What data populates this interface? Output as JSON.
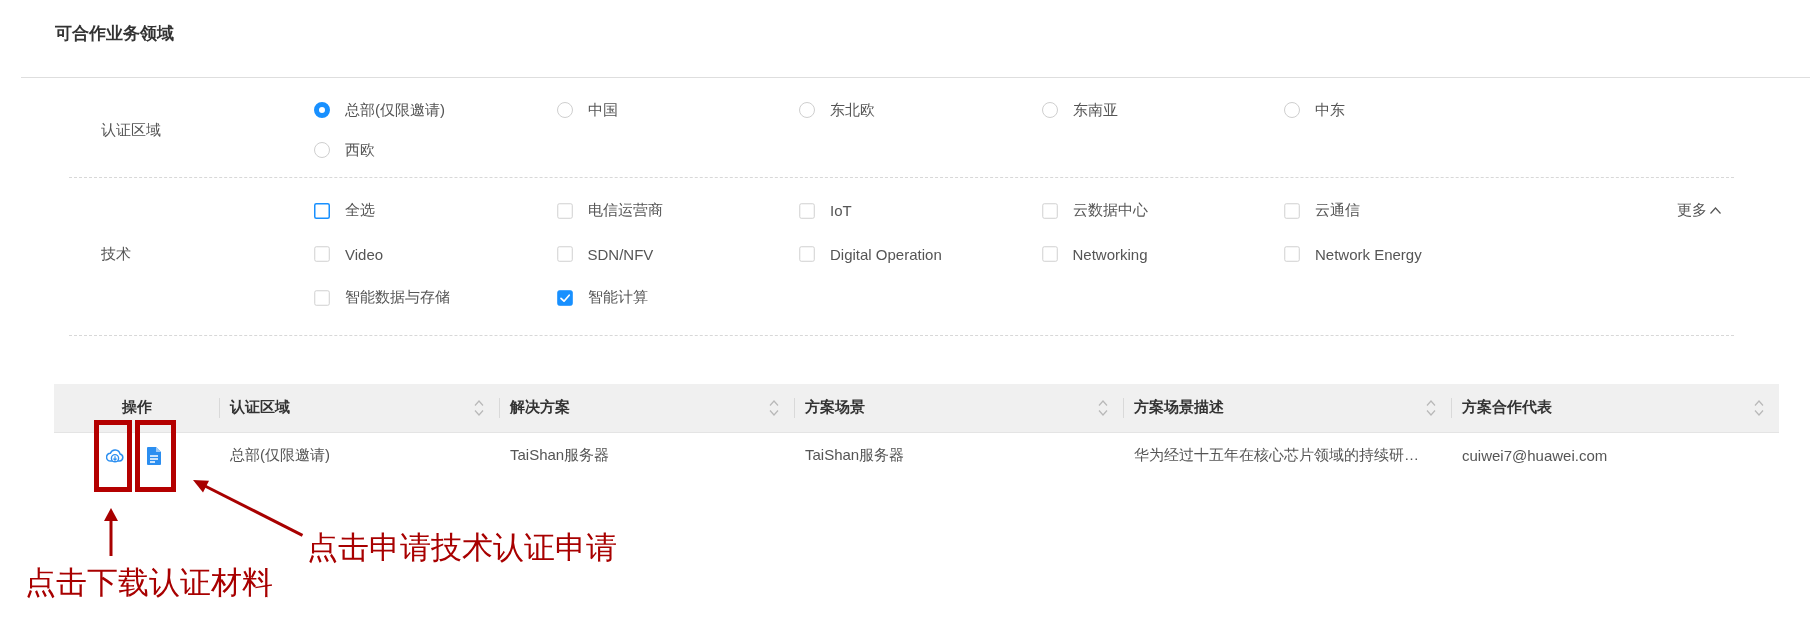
{
  "section": {
    "title": "可合作业务领域"
  },
  "filters": [
    {
      "kind": "radio",
      "label": "认证区域",
      "options": [
        {
          "label": "总部(仅限邀请)",
          "selected": true
        },
        {
          "label": "中国",
          "selected": false
        },
        {
          "label": "东北欧",
          "selected": false
        },
        {
          "label": "东南亚",
          "selected": false
        },
        {
          "label": "中东",
          "selected": false
        },
        {
          "label": "西欧",
          "selected": false
        }
      ]
    },
    {
      "kind": "checkbox",
      "label": "技术",
      "options": [
        {
          "label": "全选",
          "checked": false,
          "focused": true
        },
        {
          "label": "电信运营商",
          "checked": false,
          "focused": false
        },
        {
          "label": "IoT",
          "checked": false,
          "focused": false
        },
        {
          "label": "云数据中心",
          "checked": false,
          "focused": false
        },
        {
          "label": "云通信",
          "checked": false,
          "focused": false
        },
        {
          "label": "Video",
          "checked": false,
          "focused": false
        },
        {
          "label": "SDN/NFV",
          "checked": false,
          "focused": false
        },
        {
          "label": "Digital Operation",
          "checked": false,
          "focused": false
        },
        {
          "label": "Networking",
          "checked": false,
          "focused": false
        },
        {
          "label": "Network Energy",
          "checked": false,
          "focused": false
        },
        {
          "label": "智能数据与存储",
          "checked": false,
          "focused": false
        },
        {
          "label": "智能计算",
          "checked": true,
          "focused": false
        }
      ],
      "toggle": {
        "label": "更多",
        "expanded": true
      }
    }
  ],
  "table": {
    "columns": [
      {
        "label": "操作",
        "sortable": false
      },
      {
        "label": "认证区域",
        "sortable": true
      },
      {
        "label": "解决方案",
        "sortable": true
      },
      {
        "label": "方案场景",
        "sortable": true
      },
      {
        "label": "方案场景描述",
        "sortable": true
      },
      {
        "label": "方案合作代表",
        "sortable": true
      }
    ],
    "rows": [
      {
        "cells": [
          {
            "kind": "actions",
            "actions": [
              {
                "kind": "download"
              },
              {
                "kind": "document"
              }
            ]
          },
          {
            "kind": "text",
            "text": "总部(仅限邀请)"
          },
          {
            "kind": "text",
            "text": "TaiShan服务器"
          },
          {
            "kind": "text",
            "text": "TaiShan服务器"
          },
          {
            "kind": "text",
            "text": "华为经过十五年在核心芯片领域的持续研…"
          },
          {
            "kind": "text",
            "text": "cuiwei7@huawei.com"
          }
        ]
      }
    ]
  },
  "annotations": [
    {
      "kind": "up-arrow",
      "text": "点击下载认证材料"
    },
    {
      "kind": "diagonal-arrow",
      "text": "点击申请技术认证申请"
    }
  ]
}
